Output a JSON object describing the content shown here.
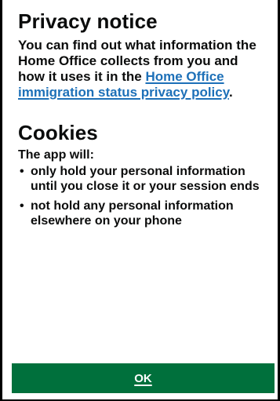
{
  "privacy": {
    "title": "Privacy notice",
    "text_before_link": "You can find out what information the Home Office collects from you and how it uses it in the ",
    "link_text": "Home Office immigration status privacy policy",
    "text_after_link": "."
  },
  "cookies": {
    "title": "Cookies",
    "intro": "The app will:",
    "items": [
      "only hold your personal information until you close it or your session ends",
      "not hold any personal information elsewhere on your phone"
    ]
  },
  "footer": {
    "ok_label": "OK"
  },
  "colors": {
    "button_background": "#00703c",
    "link": "#1d70b8",
    "text": "#0b0c0c"
  }
}
